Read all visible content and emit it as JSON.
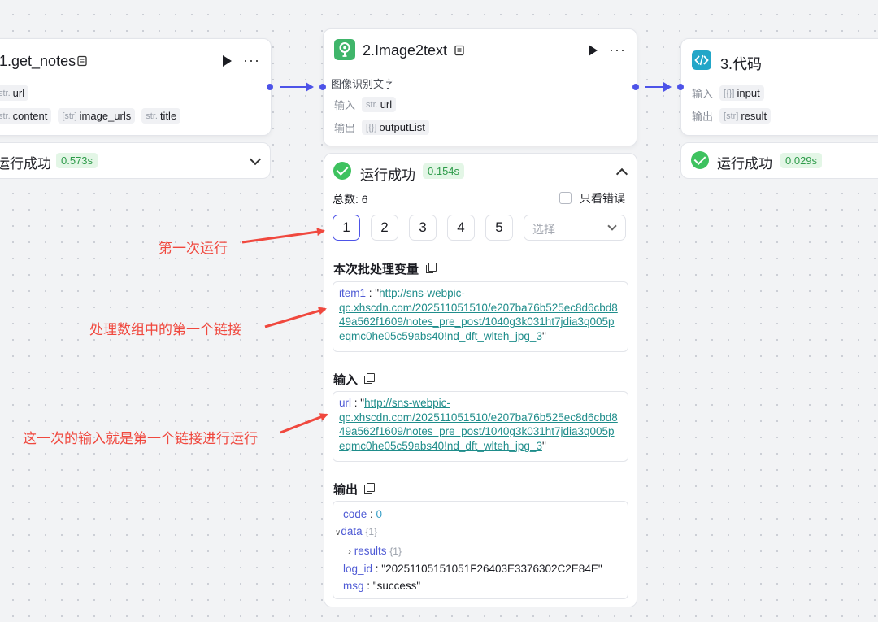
{
  "colors": {
    "accent": "#4d53e8",
    "success": "#3ec25f",
    "annotation": "#f0483e",
    "link": "#1f8d8b"
  },
  "node1": {
    "title": "1.get_notes",
    "icon": "document-icon",
    "input_type": "str.",
    "input_name": "url",
    "outputs": [
      {
        "type": "str.",
        "name": "content"
      },
      {
        "type": "[str]",
        "name": "image_urls"
      },
      {
        "type": "str.",
        "name": "title"
      }
    ],
    "status": "运行成功",
    "time": "0.573s"
  },
  "node2": {
    "title": "2.Image2text",
    "icon": "lightbulb-icon",
    "description": "图像识别文字",
    "input_label": "输入",
    "input_type": "str.",
    "input_name": "url",
    "output_label": "输出",
    "output_type": "[{}]",
    "output_name": "outputList"
  },
  "node3": {
    "title": "3.代码",
    "icon": "code-icon",
    "input_label": "输入",
    "input_type": "[{}]",
    "input_name": "input",
    "output_label": "输出",
    "output_type": "[str]",
    "output_name": "result",
    "status": "运行成功",
    "time": "0.029s"
  },
  "panel": {
    "status": "运行成功",
    "time": "0.154s",
    "total": "总数: 6",
    "errors_only": "只看错误",
    "pages": [
      "1",
      "2",
      "3",
      "4",
      "5"
    ],
    "select_placeholder": "选择",
    "batch_title": "本次批处理变量",
    "batch_key": "item1",
    "batch_url": "http://sns-webpic-qc.xhscdn.com/202511051510/e207ba76b525ec8d6cbd849a562f1609/notes_pre_post/1040g3k031ht7jdia3q005peqmc0he05c59abs40!nd_dft_wlteh_jpg_3",
    "batch_url_lines": [
      "http://sns-webpic-",
      "qc.xhscdn.com/202511051510/e207ba76b525ec8d6cbd8",
      "49a562f1609/notes_pre_post/1040g3k031ht7jdia3q005p",
      "eqmc0he05c59abs40!nd_dft_wlteh_jpg_3"
    ],
    "input_title": "输入",
    "input_key": "url",
    "input_url_lines": [
      "http://sns-webpic-",
      "qc.xhscdn.com/202511051510/e207ba76b525ec8d6cbd8",
      "49a562f1609/notes_pre_post/1040g3k031ht7jdia3q005p",
      "eqmc0he05c59abs40!nd_dft_wlteh_jpg_3"
    ],
    "output_title": "输出",
    "output": {
      "code_key": "code",
      "code_val": "0",
      "data_key": "data",
      "data_count": "{1}",
      "results_key": "results",
      "results_count": "{1}",
      "log_id_key": "log_id",
      "log_id_val": "\"20251105151051F26403E3376302C2E84E\"",
      "msg_key": "msg",
      "msg_val": "\"success\""
    }
  },
  "annotations": [
    "第一次运行",
    "处理数组中的第一个链接",
    "这一次的输入就是第一个链接进行运行"
  ]
}
